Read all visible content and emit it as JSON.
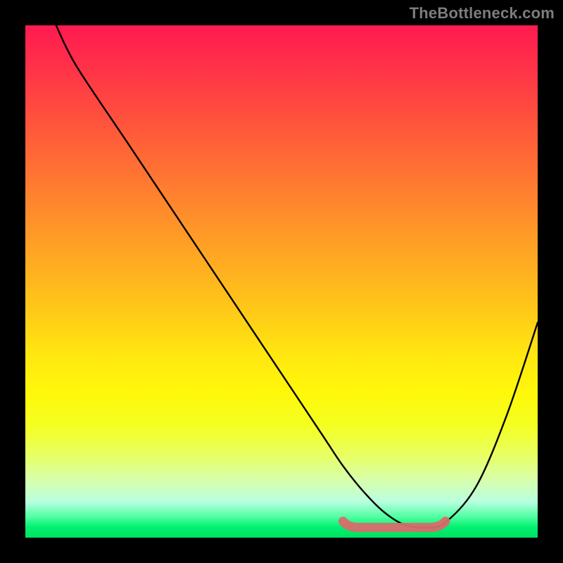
{
  "watermark": "TheBottleneck.com",
  "chart_data": {
    "type": "line",
    "title": "",
    "xlabel": "",
    "ylabel": "",
    "xlim": [
      0,
      100
    ],
    "ylim": [
      0,
      100
    ],
    "background_gradient": {
      "top": "#ff1a51",
      "bottom": "#00e060"
    },
    "series": [
      {
        "name": "bottleneck-curve",
        "x": [
          6,
          10,
          20,
          30,
          40,
          50,
          58,
          62,
          66,
          70,
          74,
          78,
          82,
          88,
          94,
          100
        ],
        "y": [
          100,
          92,
          77,
          62,
          47,
          32,
          20,
          14,
          9,
          5,
          2.5,
          2,
          3,
          10,
          24,
          42
        ]
      }
    ],
    "optimal_band": {
      "x_start": 62,
      "x_end": 82,
      "y": 2
    }
  }
}
